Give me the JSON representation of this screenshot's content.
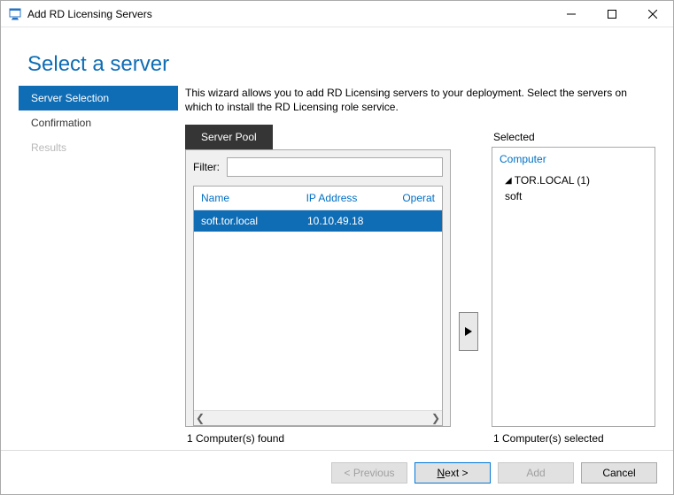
{
  "window": {
    "title": "Add RD Licensing Servers"
  },
  "heading": "Select a server",
  "sidebar": {
    "items": [
      {
        "label": "Server Selection",
        "state": "selected"
      },
      {
        "label": "Confirmation",
        "state": "normal"
      },
      {
        "label": "Results",
        "state": "disabled"
      }
    ]
  },
  "description": "This wizard allows you to add RD Licensing servers to your deployment. Select the servers on which to install the RD Licensing role service.",
  "pool": {
    "tab": "Server Pool",
    "filter_label": "Filter:",
    "filter_value": "",
    "columns": {
      "name": "Name",
      "ip": "IP Address",
      "os": "Operat"
    },
    "rows": [
      {
        "name": "soft.tor.local",
        "ip": "10.10.49.18",
        "os": ""
      }
    ],
    "count_text": "1 Computer(s) found"
  },
  "selected": {
    "label": "Selected",
    "header": "Computer",
    "domain": "TOR.LOCAL (1)",
    "items": [
      "soft"
    ],
    "count_text": "1 Computer(s) selected"
  },
  "buttons": {
    "previous": "< Previous",
    "next_prefix": "N",
    "next_suffix": "ext >",
    "add": "Add",
    "cancel": "Cancel"
  }
}
